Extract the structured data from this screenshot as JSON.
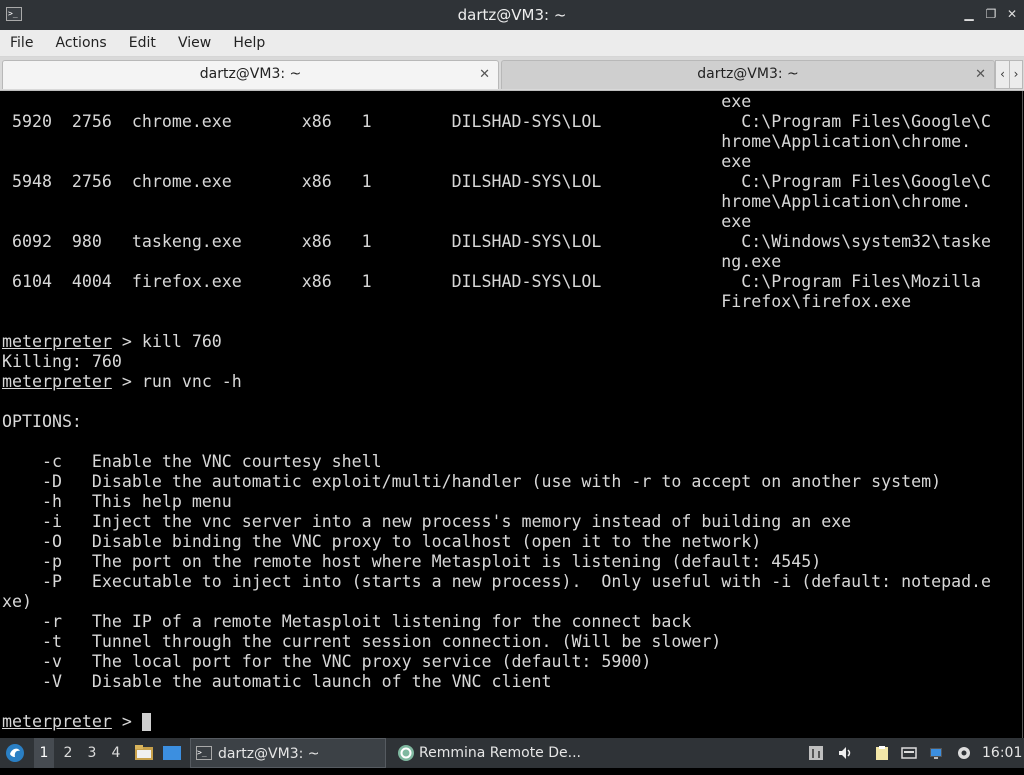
{
  "window": {
    "title": "dartz@VM3: ~",
    "app_icon": "terminal-icon",
    "buttons": [
      "minimize-icon",
      "maximize-icon",
      "close-icon"
    ]
  },
  "menu": [
    "File",
    "Actions",
    "Edit",
    "View",
    "Help"
  ],
  "tabs": [
    {
      "label": "dartz@VM3: ~",
      "active": true
    },
    {
      "label": "dartz@VM3: ~",
      "active": false
    }
  ],
  "terminal": {
    "lines": [
      {
        "text": "                                                                        exe"
      },
      {
        "text": " 5920  2756  chrome.exe       x86   1        DILSHAD-SYS\\LOL              C:\\Program Files\\Google\\C"
      },
      {
        "text": "                                                                        hrome\\Application\\chrome."
      },
      {
        "text": "                                                                        exe"
      },
      {
        "text": " 5948  2756  chrome.exe       x86   1        DILSHAD-SYS\\LOL              C:\\Program Files\\Google\\C"
      },
      {
        "text": "                                                                        hrome\\Application\\chrome."
      },
      {
        "text": "                                                                        exe"
      },
      {
        "text": " 6092  980   taskeng.exe      x86   1        DILSHAD-SYS\\LOL              C:\\Windows\\system32\\taske"
      },
      {
        "text": "                                                                        ng.exe"
      },
      {
        "text": " 6104  4004  firefox.exe      x86   1        DILSHAD-SYS\\LOL              C:\\Program Files\\Mozilla"
      },
      {
        "text": "                                                                        Firefox\\firefox.exe"
      },
      {
        "text": ""
      },
      {
        "prompt": "meterpreter",
        "text": " > kill 760"
      },
      {
        "text": "Killing: 760"
      },
      {
        "prompt": "meterpreter",
        "text": " > run vnc -h"
      },
      {
        "text": ""
      },
      {
        "text": "OPTIONS:"
      },
      {
        "text": ""
      },
      {
        "text": "    -c   Enable the VNC courtesy shell"
      },
      {
        "text": "    -D   Disable the automatic exploit/multi/handler (use with -r to accept on another system)"
      },
      {
        "text": "    -h   This help menu"
      },
      {
        "text": "    -i   Inject the vnc server into a new process's memory instead of building an exe"
      },
      {
        "text": "    -O   Disable binding the VNC proxy to localhost (open it to the network)"
      },
      {
        "text": "    -p   The port on the remote host where Metasploit is listening (default: 4545)"
      },
      {
        "text": "    -P   Executable to inject into (starts a new process).  Only useful with -i (default: notepad.e"
      },
      {
        "text": "xe)"
      },
      {
        "text": "    -r   The IP of a remote Metasploit listening for the connect back"
      },
      {
        "text": "    -t   Tunnel through the current session connection. (Will be slower)"
      },
      {
        "text": "    -v   The local port for the VNC proxy service (default: 5900)"
      },
      {
        "text": "    -V   Disable the automatic launch of the VNC client"
      },
      {
        "text": ""
      },
      {
        "prompt": "meterpreter",
        "text": " > "
      }
    ]
  },
  "taskbar": {
    "start_icon": "lxqt-start-icon",
    "workspaces": [
      "1",
      "2",
      "3",
      "4"
    ],
    "active_workspace": "1",
    "quicklaunch": [
      "file-manager-icon",
      "show-desktop-icon"
    ],
    "tasks": [
      {
        "label": "dartz@VM3: ~",
        "icon": "terminal-icon"
      },
      {
        "label": "Remmina Remote De...",
        "icon": "remmina-icon"
      }
    ],
    "tray": [
      "volume-mixer-icon",
      "speaker-icon",
      "clipboard-icon",
      "keyboard-icon",
      "network-icon",
      "settings-icon"
    ],
    "clock": "16:01"
  },
  "colors": {
    "terminal_bg": "#000000",
    "terminal_fg": "#d8d8d8",
    "titlebar_bg": "#2f3337",
    "menubar_bg": "#ececec"
  }
}
